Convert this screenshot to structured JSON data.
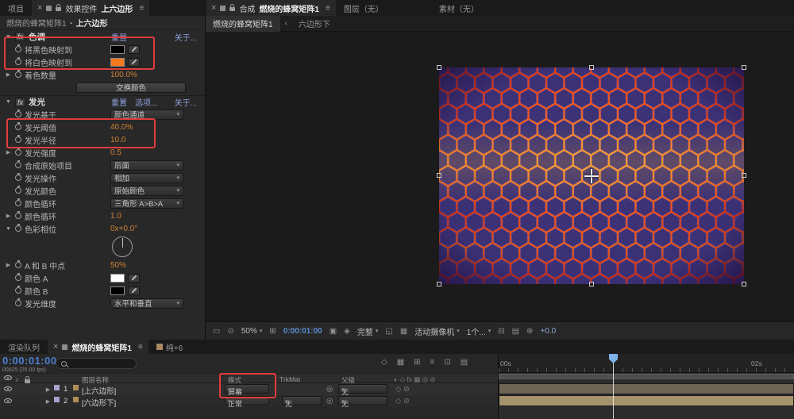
{
  "colors": {
    "annotation": "#e13c3c",
    "tint_black": "#000000",
    "tint_white": "#f5791d",
    "glow_color_a": "#ffffff",
    "glow_color_b": "#000000"
  },
  "ec": {
    "tab_project": "项目",
    "tab_label": "效果控件",
    "tab_target": "上六边形",
    "breadcrumb_comp": "燃烧的蜂窝矩阵1",
    "breadcrumb_sep": "・",
    "breadcrumb_layer": "上六边形",
    "tint": {
      "title": "色调",
      "reset": "重置",
      "about": "关于...",
      "map_black_label": "将黑色映射到",
      "map_white_label": "将白色映射到",
      "amount_label": "着色数量",
      "amount_value": "100.0%",
      "swap_button": "交换颜色"
    },
    "glow": {
      "title": "发光",
      "reset": "重置",
      "options": "选项...",
      "about": "关于...",
      "based_label": "发光基于",
      "based_value": "颜色通道",
      "threshold_label": "发光阈值",
      "threshold_value": "40.0%",
      "radius_label": "发光半径",
      "radius_value": "10.0",
      "intensity_label": "发光强度",
      "intensity_value": "0.5",
      "composite_label": "合成原始项目",
      "composite_value": "后面",
      "operation_label": "发光操作",
      "operation_value": "相加",
      "colors_label": "发光颜色",
      "colors_value": "原始颜色",
      "loop_label": "颜色循环",
      "loop_value": "三角形 A>B>A",
      "loops_label": "颜色循环",
      "loops_value": "1.0",
      "phase_label": "色彩相位",
      "phase_value": "0x+0.0°",
      "midpoint_label": "A 和 B 中点",
      "midpoint_value": "50%",
      "color_a_label": "颜色 A",
      "color_b_label": "颜色 B",
      "dimensions_label": "发光维度",
      "dimensions_value": "水平和垂直"
    }
  },
  "comp": {
    "tab_label": "合成",
    "tab_name": "燃烧的蜂窝矩阵1",
    "tab_layer": "图层（无）",
    "tab_footage": "素材（无）",
    "view_tab_active": "燃烧的蜂窝矩阵1",
    "view_tab_other": "六边形下",
    "zoom": "50%",
    "timecode": "0:00:01:00",
    "resolution": "完整",
    "camera": "活动摄像机",
    "view_count": "1个...",
    "exposure": "+0.0"
  },
  "tl": {
    "tab_queue": "渲染队列",
    "tab_comp": "燃烧的蜂窝矩阵1",
    "tab_solid": "纯+6",
    "timecode": "0:00:01:00",
    "frame_info": "00025 (25.00 fps)",
    "columns": {
      "name": "图层名称",
      "mode": "模式",
      "trkmat": "TrkMat",
      "parent": "父级"
    },
    "rows": [
      {
        "num": "1",
        "name": "[上六边形]",
        "mode": "屏幕",
        "trkmat": "",
        "parent": "无"
      },
      {
        "num": "2",
        "name": "[六边形下]",
        "mode": "正常",
        "trkmat": "无",
        "parent": "无"
      }
    ],
    "ruler_start": "00s",
    "ruler_end": "02s"
  }
}
